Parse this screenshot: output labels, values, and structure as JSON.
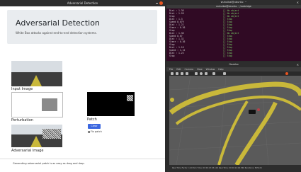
{
  "left_window": {
    "title": "Adversarial Detection",
    "hero_title": "Adversarial Detection",
    "hero_subtitle": "White Box attacks against end-to-end detection systems.",
    "input_label": "Input Image",
    "perturbation_label": "Perturbation",
    "patch_label": "Patch",
    "adversarial_label": "Adversarial Image",
    "clear_patch_button": "Clear Patch",
    "fix_patch_label": "Fix patch",
    "footer_text": "Generating adversarial patch is as easy as drag and drop."
  },
  "terminal": {
    "title": "wuhuikai@ubuntu: ~",
    "subtitle": "wuhuikai@ubuntu: ~/rosbridge",
    "left_lines": [
      "Dist : 1.38",
      "Dist : 1.28",
      "Stop",
      "Dist : 1.3",
      "Speed 0.079",
      "Dist : 1.22",
      "Steer : 0.36",
      "Stop",
      "Dist : 1.38",
      "Speed 0.07",
      "Dist : 1.32",
      "Steer : 0.36",
      "Stop",
      "Dist : 1.18",
      "Speed : 1.12",
      "Dist : 1.23",
      "Stop"
    ],
    "right_lines": [
      "[] No object",
      "[] No object",
      "[] No object",
      "[] Stop",
      "[] Stop",
      "[] Stop",
      "[] Stop",
      "[] Stop",
      "[] No object",
      "[] Stop",
      "[] Stop",
      "[] Stop",
      "[] Stop",
      "[] Stop",
      "[] Stop",
      "[] Stop",
      "[] Stop"
    ]
  },
  "gazebo": {
    "title": "Gazebo",
    "menu": [
      "File",
      "Edit",
      "Camera",
      "View",
      "Window",
      "Help"
    ],
    "status_text": "Real Time Factor: 1.00  Sim Time: 00 00:13:45.124  Real Time: 00 00:14:02.566  Iterations: 825124"
  },
  "colors": {
    "accent_blue": "#3b67e0",
    "ubuntu_orange": "#e95420",
    "terminal_bg": "#300a24",
    "road_yellow": "#c9b83a"
  }
}
